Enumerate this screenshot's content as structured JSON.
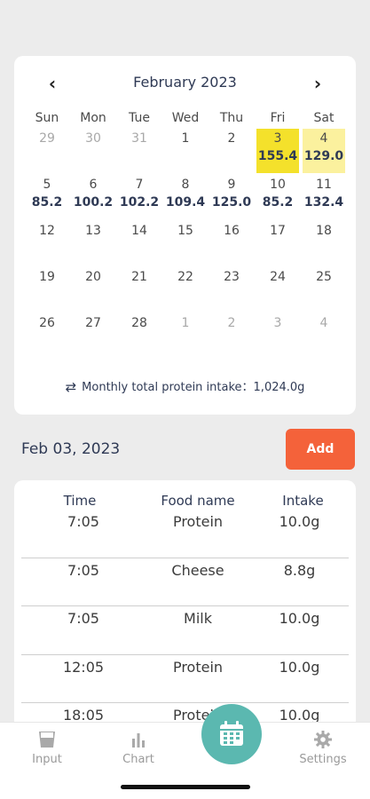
{
  "calendar": {
    "title": "February 2023",
    "prev": "‹",
    "next": "›",
    "weekdays": [
      "Sun",
      "Mon",
      "Tue",
      "Wed",
      "Thu",
      "Fri",
      "Sat"
    ],
    "days": [
      {
        "n": "29",
        "v": "",
        "other": true
      },
      {
        "n": "30",
        "v": "",
        "other": true
      },
      {
        "n": "31",
        "v": "",
        "other": true
      },
      {
        "n": "1",
        "v": ""
      },
      {
        "n": "2",
        "v": ""
      },
      {
        "n": "3",
        "v": "155.4",
        "hl": "selected"
      },
      {
        "n": "4",
        "v": "129.0",
        "hl": "light"
      },
      {
        "n": "5",
        "v": "85.2"
      },
      {
        "n": "6",
        "v": "100.2"
      },
      {
        "n": "7",
        "v": "102.2"
      },
      {
        "n": "8",
        "v": "109.4"
      },
      {
        "n": "9",
        "v": "125.0"
      },
      {
        "n": "10",
        "v": "85.2"
      },
      {
        "n": "11",
        "v": "132.4"
      },
      {
        "n": "12",
        "v": ""
      },
      {
        "n": "13",
        "v": ""
      },
      {
        "n": "14",
        "v": ""
      },
      {
        "n": "15",
        "v": ""
      },
      {
        "n": "16",
        "v": ""
      },
      {
        "n": "17",
        "v": ""
      },
      {
        "n": "18",
        "v": ""
      },
      {
        "n": "19",
        "v": ""
      },
      {
        "n": "20",
        "v": ""
      },
      {
        "n": "21",
        "v": ""
      },
      {
        "n": "22",
        "v": ""
      },
      {
        "n": "23",
        "v": ""
      },
      {
        "n": "24",
        "v": ""
      },
      {
        "n": "25",
        "v": ""
      },
      {
        "n": "26",
        "v": ""
      },
      {
        "n": "27",
        "v": ""
      },
      {
        "n": "28",
        "v": ""
      },
      {
        "n": "1",
        "v": "",
        "other": true
      },
      {
        "n": "2",
        "v": "",
        "other": true
      },
      {
        "n": "3",
        "v": "",
        "other": true
      },
      {
        "n": "4",
        "v": "",
        "other": true
      }
    ],
    "monthly_label": "Monthly total protein intake：1,024.0g",
    "monthly_icon": "sync-icon"
  },
  "selected_date": "Feb 03, 2023",
  "add_label": "Add",
  "table": {
    "headers": [
      "Time",
      "Food name",
      "Intake"
    ],
    "rows": [
      [
        "7:05",
        "Protein",
        "10.0g"
      ],
      [
        "7:05",
        "Cheese",
        "8.8g"
      ],
      [
        "7:05",
        "Milk",
        "10.0g"
      ],
      [
        "12:05",
        "Protein",
        "10.0g"
      ],
      [
        "18:05",
        "Protein",
        "10.0g"
      ]
    ]
  },
  "nav": {
    "input": "Input",
    "chart": "Chart",
    "settings": "Settings",
    "calendar_icon": "calendar-icon"
  },
  "colors": {
    "accent": "#5bb8b0",
    "add": "#f4623a",
    "highlight": "#f4e12b",
    "highlight_light": "#fbf19e"
  }
}
